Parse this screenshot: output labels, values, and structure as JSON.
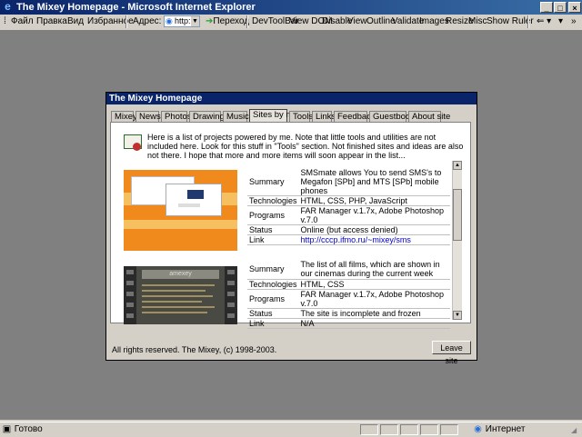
{
  "window": {
    "title": "The Mixey Homepage - Microsoft Internet Explorer"
  },
  "menu": [
    "Файл",
    "Правка",
    "Вид",
    "Избранное"
  ],
  "address": {
    "label": "Адрес:",
    "value": "http:",
    "go_label": "Переход"
  },
  "devtools": [
    "DevToolBar",
    "View DOM",
    "Disable",
    "View",
    "Outline",
    "Validate",
    "Images",
    "Resize",
    "Misc",
    "Show Ruler"
  ],
  "dialog": {
    "title": "The Mixey Homepage",
    "tabs": [
      "Mixey",
      "News",
      "Photos",
      "Drawings",
      "Music",
      "Sites by me",
      "Tools",
      "Links",
      "Feedback",
      "Guestbook",
      "About site"
    ],
    "active_tab": "Sites by me",
    "intro": "Here is a list of projects powered by me. Note that little tools and utilities are not included here. Look for this stuff in \"Tools\" section. Not finished sites and ideas are also not there. I hope that more and more items will soon appear in the list...",
    "projects": [
      {
        "shot_logo": "SMS:M8 ",
        "summary_label": "Summary",
        "summary": "SMSmate allows You to send SMS's to Megafon [SPb] and MTS [SPb] mobile phones",
        "technologies_label": "Technologies",
        "technologies": "HTML, CSS, PHP, JavaScript",
        "programs_label": "Programs",
        "programs": "FAR Manager v.1.7x, Adobe Photoshop v.7.0",
        "status_label": "Status",
        "status": "Online (but access denied)",
        "link_label": "Link",
        "link": "http://cccp.ifmo.ru/~mixey/sms"
      },
      {
        "shot_logo": "amexey",
        "summary_label": "Summary",
        "summary": "The list of all films, which are shown in our cinemas during the current week",
        "technologies_label": "Technologies",
        "technologies": "HTML, CSS",
        "programs_label": "Programs",
        "programs": "FAR Manager v.1.7x, Adobe Photoshop v.7.0",
        "status_label": "Status",
        "status": "The site is incomplete and frozen",
        "link_label": "Link",
        "link": "N/A"
      }
    ],
    "copyright": "All rights reserved. The Mixey, (c) 1998-2003.",
    "leave_button": "Leave site"
  },
  "statusbar": {
    "left": "Готово",
    "right": "Интернет"
  }
}
